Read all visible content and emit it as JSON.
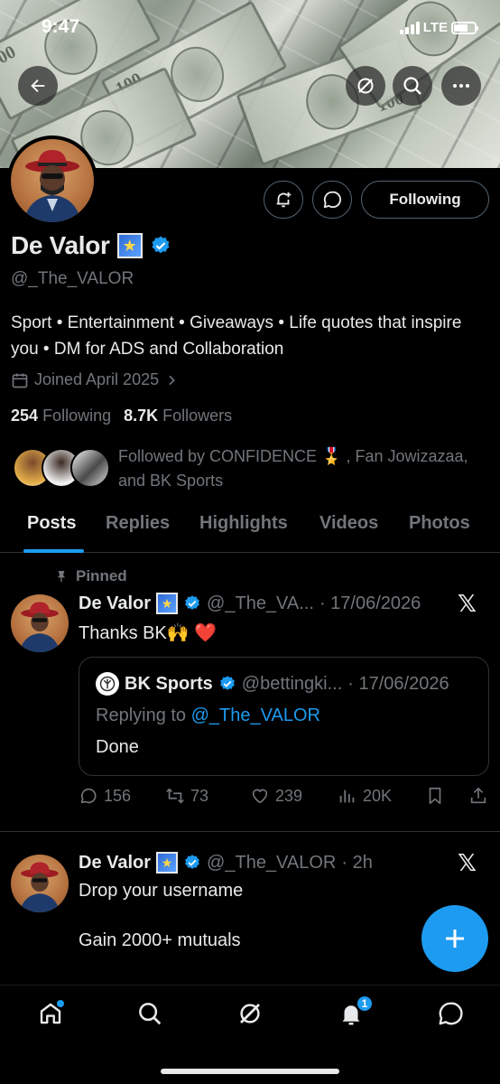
{
  "status_bar": {
    "time": "9:47",
    "network": "LTE"
  },
  "banner": {
    "bill_text_a": "100",
    "bill_text_b": "100",
    "bill_text_c": "100"
  },
  "profile": {
    "name": "De Valor",
    "handle": "@_The_VALOR",
    "bio": "Sport • Entertainment • Giveaways • Life quotes that inspire you • DM for ADS and Collaboration",
    "joined": "Joined April 2025",
    "following_count": "254",
    "following_label": "Following",
    "followers_count": "8.7K",
    "followers_label": "Followers",
    "followed_by": "Followed by CONFIDENCE 🎖️ , Fan Jowizazaa, and BK Sports",
    "follow_button": "Following"
  },
  "tabs": [
    "Posts",
    "Replies",
    "Highlights",
    "Videos",
    "Photos"
  ],
  "posts": [
    {
      "pinned_label": "Pinned",
      "name": "De Valor",
      "handle": "@_The_VA...",
      "date": "· 17/06/2026",
      "text": "Thanks BK🙌 ❤️",
      "quote": {
        "name": "BK Sports",
        "handle": "@bettingki...",
        "date": "· 17/06/2026",
        "replying_prefix": "Replying to ",
        "replying_handle": "@_The_VALOR",
        "text": "Done"
      },
      "actions": {
        "replies": "156",
        "reposts": "73",
        "likes": "239",
        "views": "20K"
      }
    },
    {
      "name": "De Valor",
      "handle": "@_The_VALOR",
      "date": "· 2h",
      "line1": "Drop your username",
      "line2": "Gain 2000+ mutuals"
    }
  ],
  "colors": {
    "accent": "#1d9bf0",
    "background": "#000000",
    "muted": "#71767b",
    "text": "#e7e9ea"
  },
  "nav": {
    "notifications_badge": "1"
  }
}
